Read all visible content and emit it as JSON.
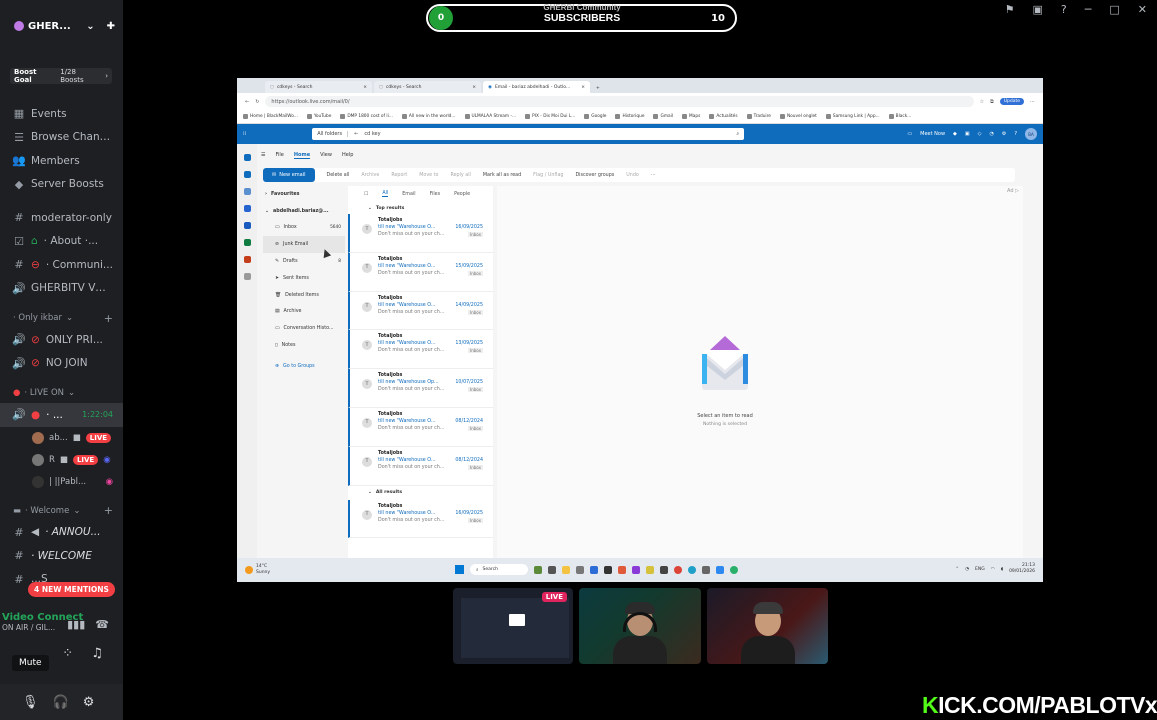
{
  "sidebar": {
    "server_name": "GHER...",
    "boost_goal": "Boost Goal",
    "boost_count": "1/28 Boosts",
    "items": [
      {
        "icon": "calendar-icon",
        "label": "Events"
      },
      {
        "icon": "channel-browse-icon",
        "label": "Browse Channels"
      },
      {
        "icon": "members-icon",
        "label": "Members"
      },
      {
        "icon": "boost-icon",
        "label": "Server Boosts"
      }
    ],
    "channels": [
      {
        "icon": "hash-icon",
        "label": "moderator-only"
      },
      {
        "icon": "rules-icon",
        "label": "· About ·..."
      },
      {
        "icon": "hash-icon",
        "label": "· Communi..."
      },
      {
        "icon": "voice-icon",
        "label": "GHERBITV VOI..."
      }
    ],
    "section_only_ikbar": "· Only ikbar",
    "only_ikbar_channels": [
      {
        "icon": "voice-icon",
        "label": "ONLY PRI..."
      },
      {
        "icon": "voice-icon",
        "label": "NO JOIN"
      }
    ],
    "section_live_on": "· LIVE ON",
    "live_channel": {
      "label": "· ...",
      "timer": "1:22:04"
    },
    "live_users": [
      {
        "name": "ab...",
        "badge": "LIVE"
      },
      {
        "name": "R",
        "badge": "LIVE"
      },
      {
        "name": "| ||Pabl...",
        "badge": ""
      }
    ],
    "section_welcome": "· Welcome",
    "welcome_channels": [
      {
        "icon": "hash-icon",
        "label": "· ANNOU..."
      },
      {
        "icon": "hash-icon",
        "label": "· WELCOME"
      },
      {
        "icon": "hash-icon",
        "label": "...S"
      }
    ],
    "new_mentions": "4 NEW MENTIONS",
    "voice_connected": "Video Connect",
    "voice_channel": "ON AIR / GIL...",
    "mute_tooltip": "Mute"
  },
  "subscribers": {
    "current": "0",
    "over_label": "GHERBI Community",
    "label": "SUBSCRIBERS",
    "goal": "10"
  },
  "browser": {
    "tabs": [
      {
        "label": "cdkeys - Search"
      },
      {
        "label": "cdkeys - Search"
      },
      {
        "label": "Email - bariaz abdelhadi - Outlo..."
      }
    ],
    "url": "https://outlook.live.com/mail/0/",
    "update_label": "Update",
    "bookmarks": [
      "Home | BlackMailWo...",
      "YouTube",
      "DMP 1800 cost of li...",
      "All new in the world...",
      "ULMALAA Stream -...",
      "PIX - Dis Moi Dui L...",
      "Google",
      "Historique",
      "Gmail",
      "Maps",
      "Actualités",
      "Traduire",
      "Nouvel onglet",
      "Samsung Link | App...",
      "Black..."
    ]
  },
  "outlook": {
    "scope": "All folders",
    "search_value": "cd key",
    "meet_now": "Meet Now",
    "avatar": "BA",
    "menu_tabs": [
      "File",
      "Home",
      "View",
      "Help"
    ],
    "ribbon": {
      "new_email": "New email",
      "delete_all": "Delete all",
      "archive": "Archive",
      "report": "Report",
      "move_to": "Move to",
      "reply_all": "Reply all",
      "mark_all_read": "Mark all as read",
      "flag": "Flag / Unflag",
      "discover_groups": "Discover groups",
      "undo": "Undo"
    },
    "favourites": "Favourites",
    "account": "abdelhadi.bariaz@...",
    "folders": [
      {
        "label": "Inbox",
        "count": "5640"
      },
      {
        "label": "Junk Email",
        "count": ""
      },
      {
        "label": "Drafts",
        "count": "8"
      },
      {
        "label": "Sent Items",
        "count": ""
      },
      {
        "label": "Deleted Items",
        "count": ""
      },
      {
        "label": "Archive",
        "count": ""
      },
      {
        "label": "Conversation Histo...",
        "count": ""
      },
      {
        "label": "Notes",
        "count": ""
      }
    ],
    "go_to_groups": "Go to Groups",
    "filters": [
      "All",
      "Email",
      "Files",
      "People"
    ],
    "top_results": "Top results",
    "all_results": "All results",
    "messages": [
      {
        "from": "Totaljobs",
        "subject": "till new \"Warehouse O...",
        "date": "16/09/2025",
        "preview": "Don't miss out on your ch...",
        "tag": "Inbox"
      },
      {
        "from": "Totaljobs",
        "subject": "till new \"Warehouse O...",
        "date": "15/09/2025",
        "preview": "Don't miss out on your ch...",
        "tag": "Inbox"
      },
      {
        "from": "Totaljobs",
        "subject": "till new \"Warehouse O...",
        "date": "14/09/2025",
        "preview": "Don't miss out on your ch...",
        "tag": "Inbox"
      },
      {
        "from": "Totaljobs",
        "subject": "till new \"Warehouse O...",
        "date": "13/09/2025",
        "preview": "Don't miss out on your ch...",
        "tag": "Inbox"
      },
      {
        "from": "Totaljobs",
        "subject": "till new \"Warehouse Op...",
        "date": "10/07/2025",
        "preview": "Don't miss out on your ch...",
        "tag": "Inbox"
      },
      {
        "from": "Totaljobs",
        "subject": "till new \"Warehouse O...",
        "date": "08/12/2024",
        "preview": "Don't miss out on your ch...",
        "tag": "Inbox"
      },
      {
        "from": "Totaljobs",
        "subject": "till new \"Warehouse O...",
        "date": "08/12/2024",
        "preview": "Don't miss out on your ch...",
        "tag": "Inbox"
      }
    ],
    "all_results_message": {
      "from": "Totaljobs",
      "subject": "till new \"Warehouse O...",
      "date": "16/09/2025",
      "preview": "Don't miss out on your ch...",
      "tag": "Inbox"
    },
    "empty_title": "Select an item to read",
    "empty_sub": "Nothing is selected"
  },
  "taskbar": {
    "temp": "14°C",
    "weather": "Sunny",
    "search": "Search",
    "lang": "ENG",
    "time": "21:13",
    "date": "09/01/2026"
  },
  "cams": {
    "live": "LIVE"
  },
  "watermark": {
    "k": "K",
    "rest": "ICK.COM/PABLOTVx"
  },
  "colors": {
    "discord_bg": "#1e1f22",
    "outlook_blue": "#0f6cbd",
    "kick_green": "#53fc18",
    "live_red": "#f23f43"
  }
}
